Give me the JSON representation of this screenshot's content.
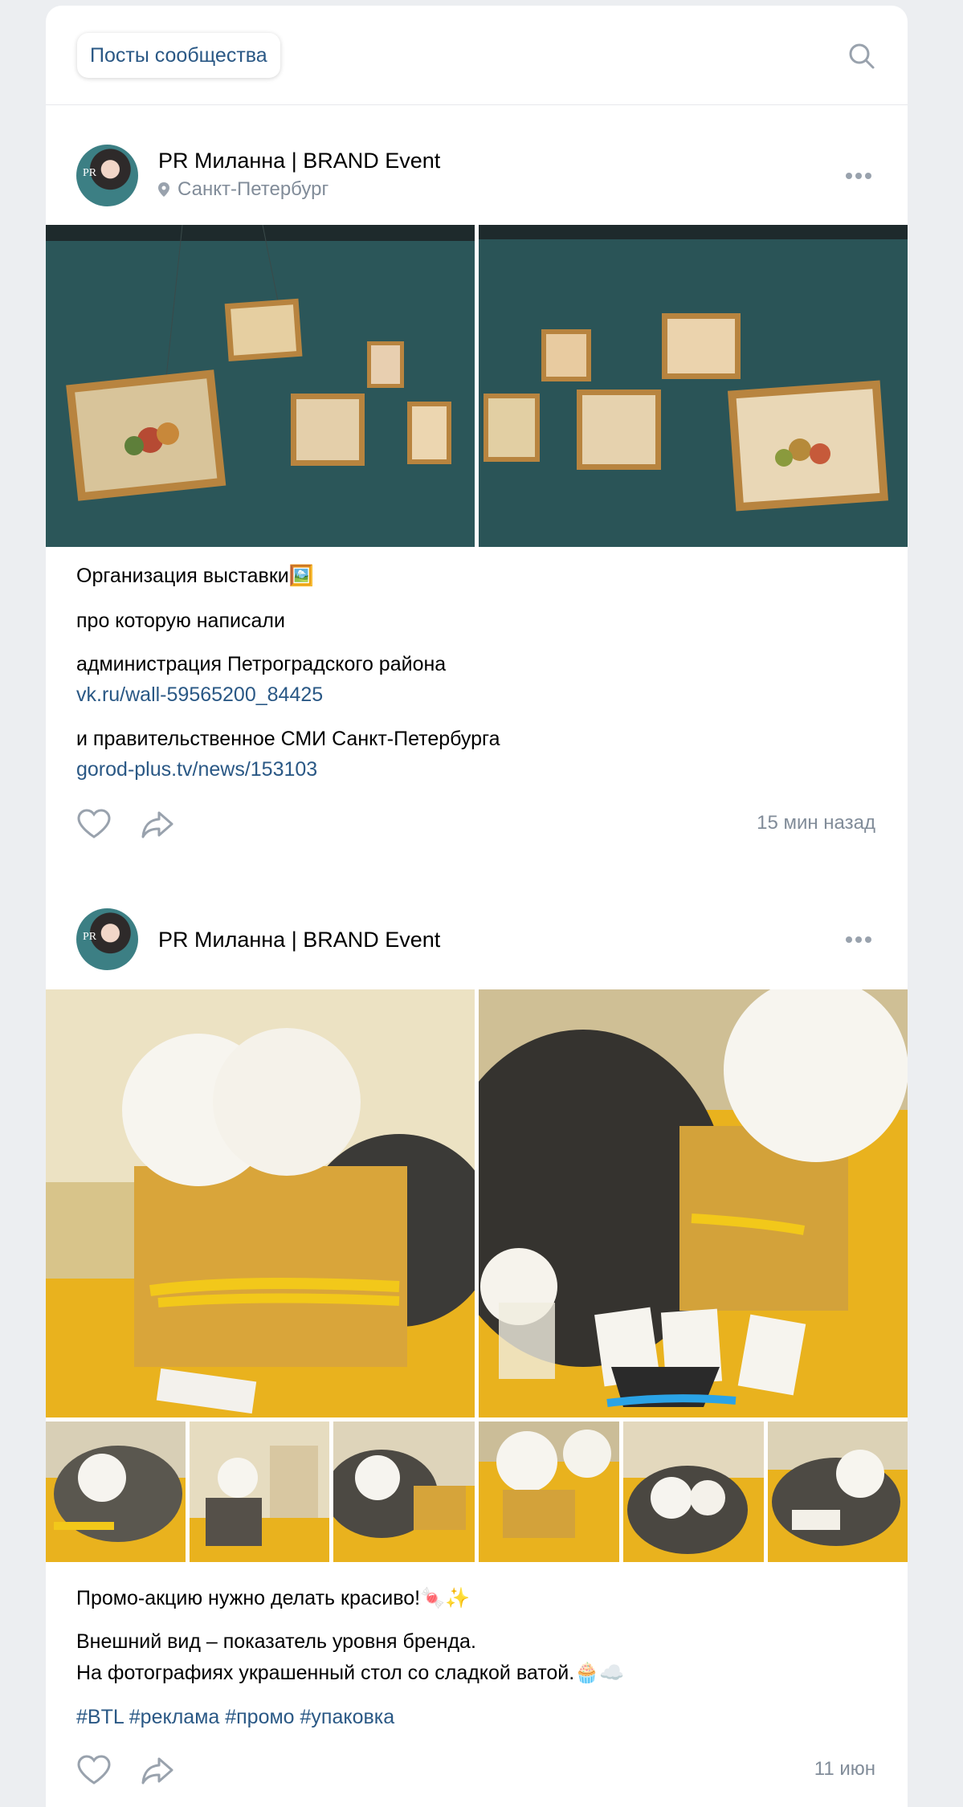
{
  "header": {
    "tab_label": "Посты сообщества",
    "search_icon": "search-icon"
  },
  "posts": [
    {
      "author": "PR Миланна | BRAND Event",
      "location": "Санкт-Петербург",
      "lines": [
        "Организация выставки🖼️",
        "про которую написали",
        "администрация Петроградского района",
        "vk.ru/wall-59565200_84425",
        "и правительственное СМИ Санкт-Петербурга",
        "gorod-plus.tv/news/153103"
      ],
      "time": "15 мин назад"
    },
    {
      "author": "PR Миланна | BRAND Event",
      "lines": [
        "Промо-акцию нужно делать красиво!🍬✨",
        "Внешний вид – показатель уровня бренда.",
        "На фотографиях украшенный стол со сладкой ватой.🧁☁️",
        "#BTL #реклама #промо #упаковка"
      ],
      "time": "11 июн"
    }
  ],
  "avatar_text": "PR",
  "colors": {
    "accent": "#2a5885",
    "muted": "#818c99",
    "background": "#eceef1",
    "wall_teal": "#2b5659",
    "promo_yellow": "#e9b21e"
  }
}
